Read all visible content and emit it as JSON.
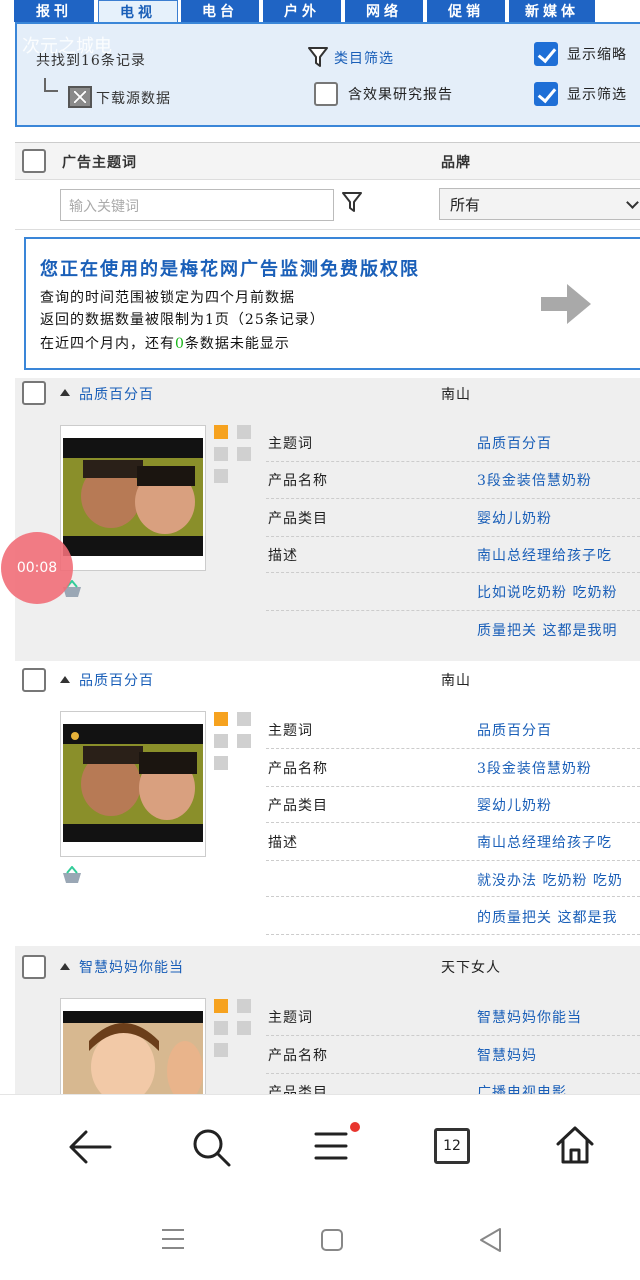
{
  "tabs": [
    {
      "label": "报刊",
      "active": false
    },
    {
      "label": "电视",
      "active": true
    },
    {
      "label": "电台",
      "active": false
    },
    {
      "label": "户外",
      "active": false
    },
    {
      "label": "网络",
      "active": false
    },
    {
      "label": "促销",
      "active": false
    },
    {
      "label": "新媒体",
      "active": false
    }
  ],
  "watermark": "次元之城电",
  "filter_panel": {
    "found_text": "共找到16条记录",
    "download_label": "下载源数据",
    "category_filter": "类目筛选",
    "include_research_label": "含效果研究报告",
    "include_research_checked": false,
    "show_thumbs_label": "显示缩略",
    "show_thumbs_checked": true,
    "show_filter_label": "显示筛选",
    "show_filter_checked": true
  },
  "table_header": {
    "col_keyword": "广告主题词",
    "col_brand": "品牌",
    "keyword_placeholder": "输入关键词",
    "brand_selected": "所有"
  },
  "notice": {
    "title": "您正在使用的是梅花网广告监测免费版权限",
    "line1": "查询的时间范围被锁定为四个月前数据",
    "line2": "返回的数据数量被限制为1页（25条记录）",
    "line3_pre": "在近四个月内，还有",
    "line3_count": "0",
    "line3_post": "条数据未能显示"
  },
  "results": [
    {
      "title": "品质百分百",
      "brand": "南山",
      "labels": {
        "theme": "主题词",
        "product": "产品名称",
        "category": "产品类目",
        "desc": "描述"
      },
      "theme": "品质百分百",
      "product": "3段金装倍慧奶粉",
      "category": "婴幼儿奶粉",
      "desc": [
        "南山总经理给孩子吃",
        "比如说吃奶粉 吃奶粉",
        "质量把关 这都是我明"
      ]
    },
    {
      "title": "品质百分百",
      "brand": "南山",
      "labels": {
        "theme": "主题词",
        "product": "产品名称",
        "category": "产品类目",
        "desc": "描述"
      },
      "theme": "品质百分百",
      "product": "3段金装倍慧奶粉",
      "category": "婴幼儿奶粉",
      "desc": [
        "南山总经理给孩子吃",
        "就没办法 吃奶粉 吃奶",
        "的质量把关 这都是我"
      ]
    },
    {
      "title": "智慧妈妈你能当",
      "brand": "天下女人",
      "labels": {
        "theme": "主题词",
        "product": "产品名称",
        "category": "产品类目"
      },
      "theme": "智慧妈妈你能当",
      "product": "智慧妈妈",
      "category": "广播电视电影"
    }
  ],
  "recording_badge": "00:08",
  "browser": {
    "tab_count": "12"
  }
}
